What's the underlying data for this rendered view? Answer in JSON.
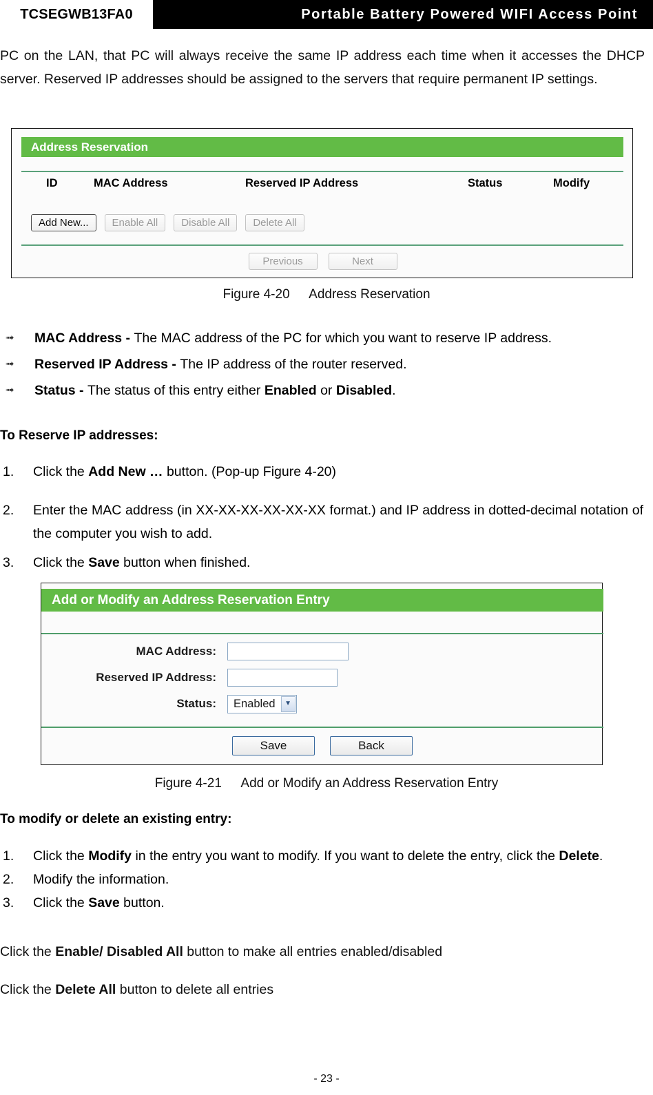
{
  "header": {
    "model": "TCSEGWB13FA0",
    "title": "Portable  Battery  Powered  WIFI  Access  Point"
  },
  "intro_paragraph": "PC on the LAN, that PC will always receive the same IP address each time when it accesses the DHCP server. Reserved IP addresses should be assigned to the servers that require permanent IP settings.",
  "figure_address_reservation": {
    "panel_title": "Address Reservation",
    "table_headers": {
      "id": "ID",
      "mac_address": "MAC Address",
      "reserved_ip_address": "Reserved IP Address",
      "status": "Status",
      "modify": "Modify"
    },
    "buttons": {
      "add_new": "Add New...",
      "enable_all": "Enable All",
      "disable_all": "Disable All",
      "delete_all": "Delete All",
      "previous": "Previous",
      "next": "Next"
    },
    "caption_label": "Figure 4-20",
    "caption_text": "Address Reservation"
  },
  "definitions": [
    {
      "term": "MAC Address - ",
      "desc": "The MAC address of the PC for which you want to reserve IP address."
    },
    {
      "term": "Reserved IP Address - ",
      "desc": "The IP address of the router reserved."
    },
    {
      "term": "Status - ",
      "desc_before": "The status of this entry either ",
      "bold_1": "Enabled",
      "mid": " or ",
      "bold_2": "Disabled",
      "desc_after": "."
    }
  ],
  "reserve_section": {
    "heading": "To Reserve IP addresses:",
    "steps": [
      {
        "num": "1.",
        "before": "Click the ",
        "bold": "Add New …",
        "after": " button. (Pop-up Figure 4-20)"
      },
      {
        "num": "2.",
        "before": "Enter the MAC address (in XX-XX-XX-XX-XX-XX format.) and IP address in dotted-decimal notation of the computer you wish to add.",
        "bold": "",
        "after": ""
      },
      {
        "num": "3.",
        "before": "Click the ",
        "bold": "Save",
        "after": " button when finished."
      }
    ]
  },
  "figure_add_modify": {
    "panel_title": "Add or Modify an Address Reservation Entry",
    "fields": {
      "mac_address_label": "MAC Address:",
      "mac_address_value": "",
      "reserved_ip_label": "Reserved IP Address:",
      "reserved_ip_value": "",
      "status_label": "Status:",
      "status_value": "Enabled",
      "status_arrow": "chevron-down-icon"
    },
    "buttons": {
      "save": "Save",
      "back": "Back"
    },
    "caption_label": "Figure 4-21",
    "caption_text": "Add or Modify an Address Reservation Entry"
  },
  "modify_section": {
    "heading": "To modify or delete an existing entry:",
    "steps": [
      {
        "num": "1.",
        "before": "Click the ",
        "bold": "Modify",
        "mid": " in the entry you want to modify. If you want to delete the entry, click the ",
        "bold2": "Delete",
        "after": "."
      },
      {
        "num": "2.",
        "before": "Modify the information.",
        "bold": "",
        "mid": "",
        "bold2": "",
        "after": ""
      },
      {
        "num": "3.",
        "before": "Click the ",
        "bold": "Save",
        "mid": " button.",
        "bold2": "",
        "after": ""
      }
    ]
  },
  "closing_paragraphs": [
    {
      "before": "Click the ",
      "bold": "Enable/ Disabled All",
      "after": " button to make all entries enabled/disabled"
    },
    {
      "before": "Click the ",
      "bold": "Delete All",
      "after": " button to delete all entries"
    }
  ],
  "page_number": "- 23 -",
  "colors": {
    "panel_green": "#62bb46",
    "rule_green": "#4f9d6a",
    "input_border_blue": "#8aa7c4",
    "button_border_blue": "#3a6a9e",
    "header_black": "#000000"
  }
}
